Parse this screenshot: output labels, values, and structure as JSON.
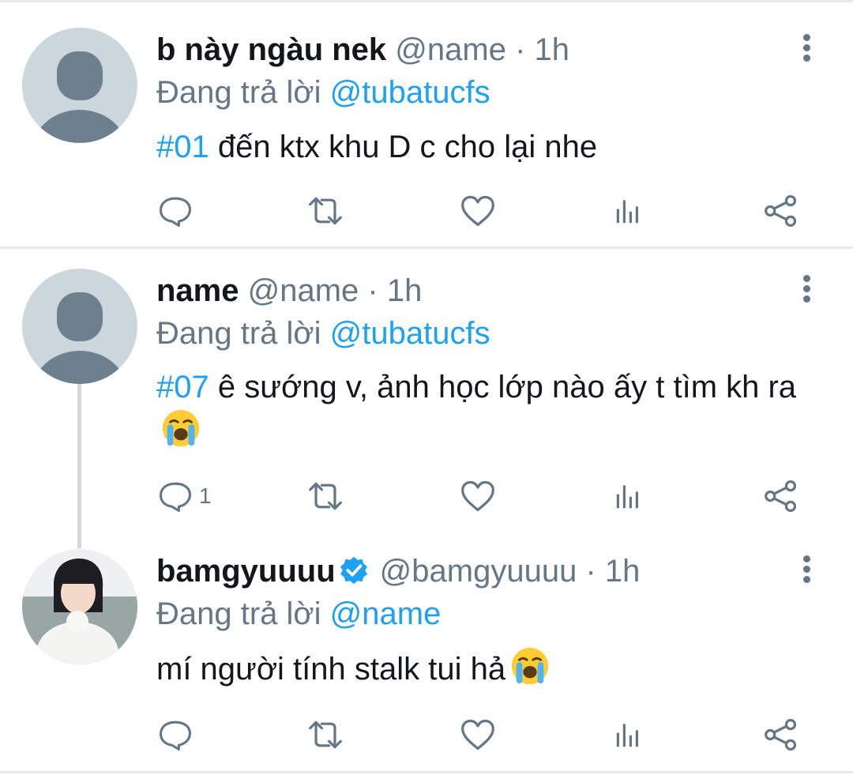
{
  "tweets": [
    {
      "name": "b này ngàu nek",
      "handle": "@name",
      "separator": "·",
      "time": "1h",
      "replying_prefix": "Đang trả lời",
      "replying_to": "@tubatucfs",
      "hashtag": "#01",
      "text": " đến ktx khu D c cho lại nhe",
      "reply_count": ""
    },
    {
      "name": "name",
      "handle": "@name",
      "separator": "·",
      "time": "1h",
      "replying_prefix": "Đang trả lời",
      "replying_to": "@tubatucfs",
      "hashtag": "#07",
      "text": " ê sướng v, ảnh học lớp nào ấy t tìm kh ra",
      "reply_count": "1"
    },
    {
      "name": "bamgyuuuu",
      "handle": "@bamgyuuuu",
      "separator": "·",
      "time": "1h",
      "replying_prefix": "Đang trả lời",
      "replying_to": "@name",
      "hashtag": "",
      "text": "mí người tính stalk tui hả",
      "reply_count": "",
      "verified": true
    }
  ],
  "colors": {
    "link": "#1da1f2",
    "muted": "#657786",
    "avatar_placeholder": "#ccd6dd",
    "avatar_figure": "#6e7f8d"
  },
  "icons": [
    "reply-icon",
    "retweet-icon",
    "like-icon",
    "analytics-icon",
    "share-icon",
    "more-icon",
    "verified-icon",
    "crying-emoji-icon"
  ]
}
